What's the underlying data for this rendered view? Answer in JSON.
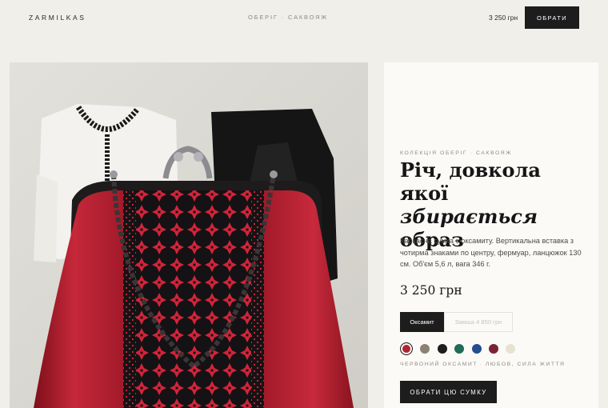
{
  "header": {
    "logo": "ZARMILKAS",
    "crumbs": [
      "ОБЕРІГ",
      "САКВОЯЖ"
    ],
    "price": "3 250 грн",
    "button": "ОБРАТИ"
  },
  "product": {
    "eyebrow_collection": "КОЛЕКЦІЯ ОБЕРІГ",
    "eyebrow_item": "САКВОЯЖ",
    "title_line1": "Річ, довкола",
    "title_line2_plain": "якої ",
    "title_line2_italic": "збирається",
    "title_line3": "образ",
    "description": "Каркасна сумка з оксамиту. Вертикальна вставка з чотирма знаками по центру, фермуар, ланцюжок 130 см. Об'єм 5,6 л, вага 346 г.",
    "price": "3 250 грн",
    "materials": [
      {
        "label": "Оксамит",
        "state": "active"
      },
      {
        "label": "Замша 4 850 грн",
        "state": "disabled"
      }
    ],
    "swatches": [
      {
        "color": "#b2222f",
        "selected": true
      },
      {
        "color": "#8c8272",
        "selected": false
      },
      {
        "color": "#1d1d1d",
        "selected": false
      },
      {
        "color": "#236b55",
        "selected": false
      },
      {
        "color": "#234e8f",
        "selected": false
      },
      {
        "color": "#7a2333",
        "selected": false
      },
      {
        "color": "#e8e2d3",
        "selected": false
      }
    ],
    "color_name": "ЧЕРВОНИЙ ОКСАМИТ",
    "color_meaning": "ЛЮБОВ, СИЛА ЖИТТЯ",
    "buy_button": "ОБРАТИ ЦЮ СУМКУ"
  }
}
